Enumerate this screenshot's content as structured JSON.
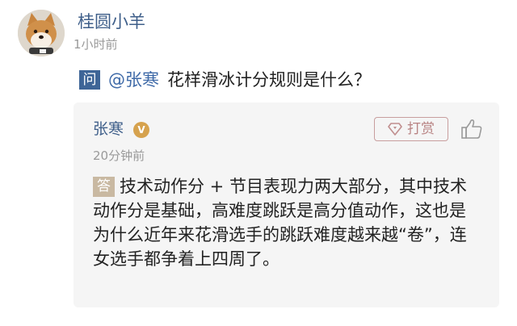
{
  "post": {
    "author": "桂圆小羊",
    "time": "1小时前"
  },
  "question": {
    "badge": "问",
    "mention": "@张寒",
    "text": "花样滑冰计分规则是什么？"
  },
  "answer": {
    "author": "张寒",
    "verified_mark": "V",
    "time": "20分钟前",
    "tip_label": "打赏",
    "badge": "答",
    "text": "技术动作分 + 节目表现力两大部分，其中技术动作分是基础，高难度跳跃是高分值动作，这也是为什么近年来花滑选手的跳跃难度越来越“卷”，连女选手都争着上四周了。"
  },
  "colors": {
    "link_blue": "#3f5f8a",
    "question_badge": "#3e6597",
    "answer_badge": "#c9b9a2",
    "tip_border": "#c89e9e",
    "card_background": "#f5f5f5"
  },
  "icons": {
    "avatar": "shiba-dog-avatar",
    "verified": "verified-v-icon",
    "tip": "diamond-tip-icon",
    "like": "thumbs-up-icon"
  }
}
